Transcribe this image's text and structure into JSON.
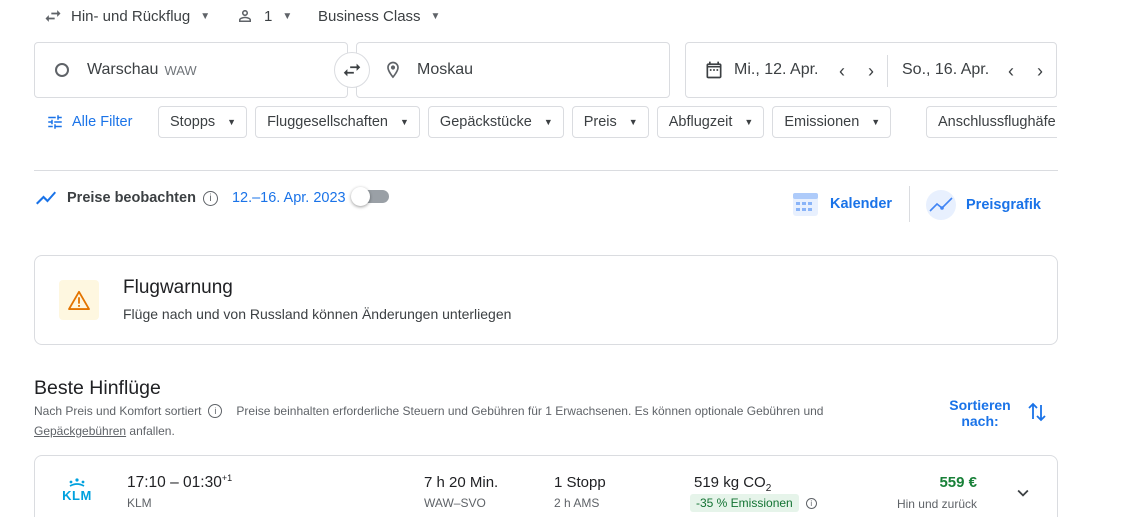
{
  "trip_type": {
    "label": "Hin- und Rückflug",
    "icon": "swap-arrows-icon"
  },
  "passengers": {
    "count": "1",
    "icon": "person-icon"
  },
  "cabin_class": {
    "label": "Business Class"
  },
  "search": {
    "origin_city": "Warschau",
    "origin_code": "WAW",
    "destination": "Moskau",
    "depart_date": "Mi., 12. Apr.",
    "return_date": "So., 16. Apr."
  },
  "filters": {
    "all_label": "Alle Filter",
    "chips": [
      "Stopps",
      "Fluggesellschaften",
      "Gepäckstücke",
      "Preis",
      "Abflugzeit",
      "Emissionen",
      "Anschlussflughäfe"
    ]
  },
  "tracking": {
    "label": "Preise beobachten",
    "dates": "12.–16. Apr. 2023",
    "enabled": false
  },
  "views": {
    "calendar_label": "Kalender",
    "price_graph_label": "Preisgrafik"
  },
  "alert": {
    "title": "Flugwarnung",
    "text": "Flüge nach und von Russland können Änderungen unterliegen"
  },
  "results": {
    "heading": "Beste Hinflüge",
    "sorted_by": "Nach Preis und Komfort sortiert",
    "info_text": "Preise beinhalten erforderliche Steuern und Gebühren für 1 Erwachsenen. Es können optionale Gebühren und",
    "baggage_link": "Gepäckgebühren",
    "info_suffix": "anfallen.",
    "sort_label_1": "Sortieren",
    "sort_label_2": "nach:"
  },
  "flights": [
    {
      "airline_logo": "KLM",
      "times": "17:10 – 01:30",
      "day_offset": "+1",
      "airline": "KLM",
      "duration": "7 h 20 Min.",
      "route": "WAW–SVO",
      "stops": "1 Stopp",
      "layover": "2 h AMS",
      "emissions_value": "519 kg CO",
      "emissions_sub": "2",
      "emissions_badge": "-35 % Emissionen",
      "price": "559 €",
      "price_note": "Hin und zurück"
    }
  ],
  "colors": {
    "accent": "#1a73e8",
    "price_green": "#188038",
    "warning": "#e37400",
    "border": "#dadce0"
  }
}
